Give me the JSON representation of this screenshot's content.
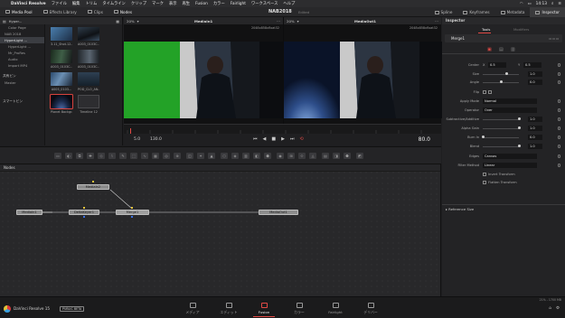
{
  "menubar": {
    "app": "DaVinci Resolve",
    "items": [
      "ファイル",
      "編集",
      "トリム",
      "タイムライン",
      "クリップ",
      "マーク",
      "表示",
      "再生",
      "Fusion",
      "カラー",
      "Fairlight",
      "ワークスペース",
      "ヘルプ"
    ],
    "clock": "14:13"
  },
  "toolbar": {
    "left": [
      "Media Pool",
      "Effects Library",
      "Clips",
      "Nodes"
    ],
    "project_title": "NAB2018",
    "edited": "Edited",
    "right": [
      "Spline",
      "Keyframes",
      "Metadata",
      "Inspector"
    ]
  },
  "media_pool": {
    "header": "Hyper...",
    "bins": [
      {
        "label": "Color Page",
        "kind": "sub"
      },
      {
        "label": "NAB 2018",
        "kind": "plain"
      },
      {
        "label": "HyperLight ...",
        "kind": "sel"
      },
      {
        "label": "HyperLight ...",
        "kind": "sub"
      },
      {
        "label": "Mr_ProRes",
        "kind": "sub"
      },
      {
        "label": "Audio",
        "kind": "sub"
      },
      {
        "label": "Import MP4",
        "kind": "sub"
      }
    ],
    "smart_bins_1": "共有ビン",
    "smart_bins_1_item": "Master",
    "smart_bins_2": "スマートビン",
    "clips": [
      {
        "label": "3.11_Shot.12...",
        "color": "#3d5a78"
      },
      {
        "label": "A003_0103C...",
        "color": "#1a2028"
      },
      {
        "label": "A003_0103C...",
        "color": "#1f2a22"
      },
      {
        "label": "A003_0103C...",
        "color": "#2a3036"
      },
      {
        "label": "A005_0103...",
        "color": "#273f5a"
      },
      {
        "label": "POD_CLO_AN...",
        "color": "#263746"
      },
      {
        "label": "Planet Backgr...",
        "color": "#141c2e"
      },
      {
        "label": "Timeline 12",
        "color": "#2e2e30"
      }
    ]
  },
  "viewer1": {
    "title": "MediaIn1",
    "zoom": "20%",
    "res": "2048x858xfloat32"
  },
  "viewer2": {
    "title": "MediaOut1",
    "zoom": "20%",
    "res": "2048x858xfloat32"
  },
  "transport": {
    "in_frame": "5.0",
    "out_frame": "130.0",
    "timecode": "80.0"
  },
  "node_editor": {
    "title": "Nodes",
    "nodes": {
      "mediain": "MediaIn1",
      "media2": "MediaIn2",
      "delta": "DeltaKeyer1",
      "merge": "Merge1",
      "mediaout": "MediaOut1"
    }
  },
  "inspector": {
    "title": "Inspector",
    "tabs": {
      "tools": "Tools",
      "modifiers": "Modifiers"
    },
    "node": "Merge1",
    "props": {
      "center_label": "Center",
      "center_x_label": "X",
      "center_x": "0.5",
      "center_y_label": "Y",
      "center_y": "0.5",
      "size_label": "Size",
      "size": "1.0",
      "angle_label": "Angle",
      "angle": "0.0",
      "flip_label": "Flip",
      "apply_mode_label": "Apply Mode",
      "apply_mode": "Normal",
      "operator_label": "Operator",
      "operator": "Over",
      "subtractive_label": "Subtractive/Additive",
      "subtractive": "1.0",
      "alpha_gain_label": "Alpha Gain",
      "alpha_gain": "1.0",
      "burn_in_label": "Burn In",
      "burn_in": "0.0",
      "blend_label": "Blend",
      "blend": "1.0",
      "edges_label": "Edges",
      "edges": "Canvas",
      "filter_label": "Filter Method",
      "filter": "Linear",
      "invert_label": "Invert Transform",
      "flatten_label": "Flatten Transform",
      "reference_size": "Reference Size"
    }
  },
  "pagebar": {
    "app": "DaVinci Resolve 15",
    "beta": "PUBLIC BETA",
    "pages": [
      "メディア",
      "エディット",
      "Fusion",
      "カラー",
      "Fairlight",
      "デリバー"
    ],
    "active_page": "Fusion",
    "memory": "21% - 1700 MB"
  },
  "colors": {
    "accent": "#e34a45",
    "green_screen": "#23a227"
  }
}
